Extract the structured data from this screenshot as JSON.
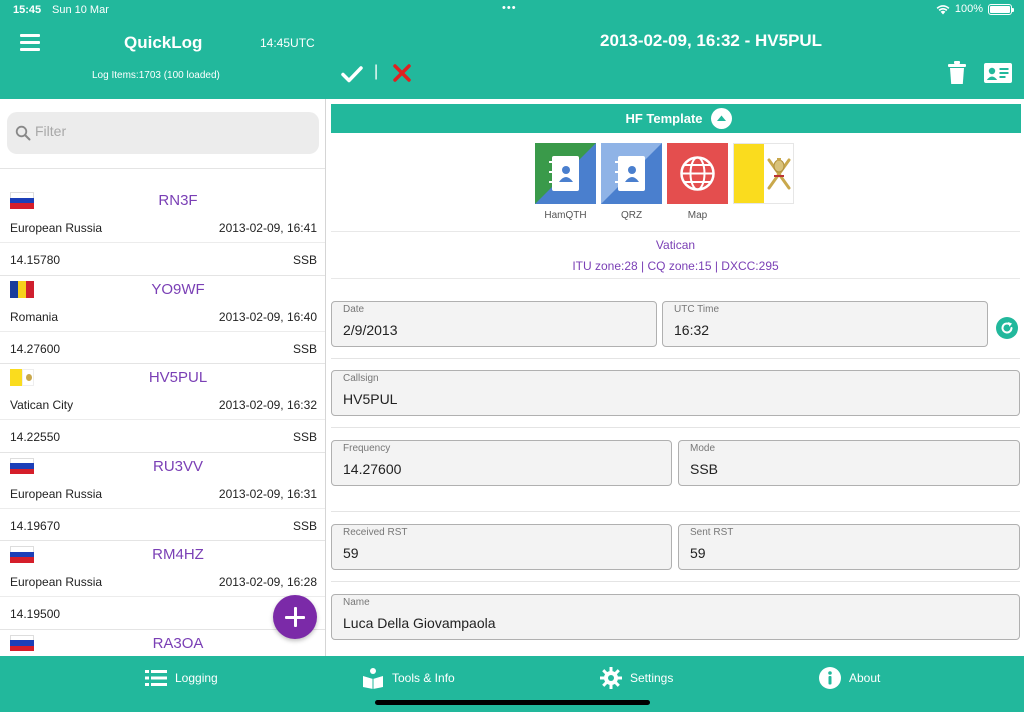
{
  "status_bar": {
    "time": "15:45",
    "date": "Sun 10 Mar",
    "battery": "100%"
  },
  "header": {
    "app_title": "QuickLog",
    "utc_clock": "14:45UTC",
    "log_items": "Log Items:1703 (100 loaded)",
    "detail_title": "2013-02-09, 16:32 - HV5PUL",
    "separator": "|"
  },
  "sidebar": {
    "filter_placeholder": "Filter",
    "items": [
      {
        "callsign": "RN3F",
        "country": "European Russia",
        "timestamp": "2013-02-09, 16:41",
        "freq": "14.15780",
        "mode": "SSB",
        "flag": "russia"
      },
      {
        "callsign": "YO9WF",
        "country": "Romania",
        "timestamp": "2013-02-09, 16:40",
        "freq": "14.27600",
        "mode": "SSB",
        "flag": "romania"
      },
      {
        "callsign": "HV5PUL",
        "country": "Vatican City",
        "timestamp": "2013-02-09, 16:32",
        "freq": "14.22550",
        "mode": "SSB",
        "flag": "vatican"
      },
      {
        "callsign": "RU3VV",
        "country": "European Russia",
        "timestamp": "2013-02-09, 16:31",
        "freq": "14.19670",
        "mode": "SSB",
        "flag": "russia"
      },
      {
        "callsign": "RM4HZ",
        "country": "European Russia",
        "timestamp": "2013-02-09, 16:28",
        "freq": "14.19500",
        "mode": "",
        "flag": "russia"
      },
      {
        "callsign": "RA3OA",
        "country": "",
        "timestamp": "",
        "freq": "",
        "mode": "",
        "flag": "russia"
      }
    ]
  },
  "detail": {
    "template_label": "HF Template",
    "lookups": [
      {
        "label": "HamQTH",
        "icon": "contact-book-icon",
        "color": "#3a9a4a"
      },
      {
        "label": "QRZ",
        "icon": "contact-book-icon",
        "color": "#5a8fd0"
      },
      {
        "label": "Map",
        "icon": "globe-icon",
        "color": "#e44e4e"
      }
    ],
    "entity": "Vatican",
    "zones": "ITU zone:28 | CQ zone:15 | DXCC:295",
    "fields": {
      "date": {
        "label": "Date",
        "value": "2/9/2013"
      },
      "utc_time": {
        "label": "UTC Time",
        "value": "16:32"
      },
      "callsign": {
        "label": "Callsign",
        "value": "HV5PUL"
      },
      "frequency": {
        "label": "Frequency",
        "value": "14.27600"
      },
      "mode": {
        "label": "Mode",
        "value": "SSB"
      },
      "rst_rcvd": {
        "label": "Received RST",
        "value": "59"
      },
      "rst_sent": {
        "label": "Sent RST",
        "value": "59"
      },
      "name": {
        "label": "Name",
        "value": "Luca Della Giovampaola"
      }
    }
  },
  "tabs": [
    {
      "label": "Logging",
      "icon": "list-icon"
    },
    {
      "label": "Tools & Info",
      "icon": "book-icon"
    },
    {
      "label": "Settings",
      "icon": "gear-icon"
    },
    {
      "label": "About",
      "icon": "info-icon"
    }
  ],
  "colors": {
    "accent": "#22b89c",
    "callsign": "#7a3fb5",
    "add_button": "#7b2aa8",
    "cancel": "#e02020"
  }
}
